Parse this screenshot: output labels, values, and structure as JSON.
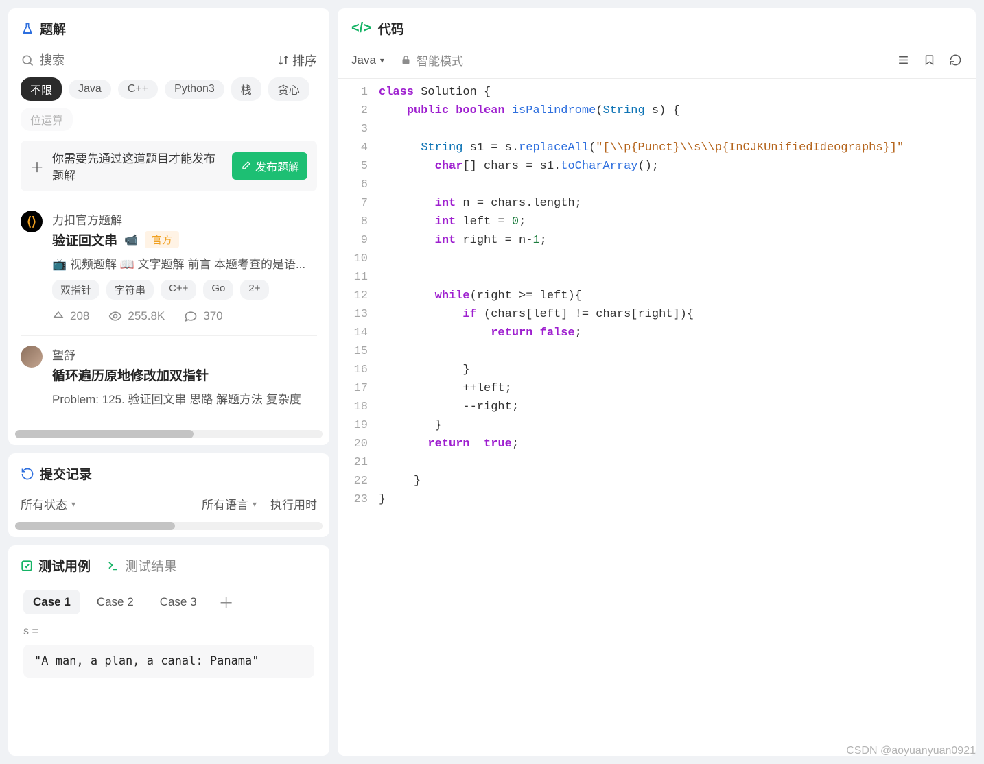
{
  "left": {
    "solutions": {
      "title": "题解",
      "search_placeholder": "搜索",
      "sort_label": "排序",
      "filters": [
        {
          "label": "不限",
          "active": true
        },
        {
          "label": "Java"
        },
        {
          "label": "C++"
        },
        {
          "label": "Python3"
        },
        {
          "label": "栈"
        },
        {
          "label": "贪心"
        },
        {
          "label": "位运算",
          "faded": true
        }
      ],
      "publish_hint": "你需要先通过这道题目才能发布题解",
      "publish_button": "发布题解",
      "items": [
        {
          "author": "力扣官方题解",
          "title": "验证回文串",
          "official_badge": "官方",
          "description": "📺 视频题解 📖 文字题解 前言 本题考查的是语...",
          "tags": [
            "双指针",
            "字符串",
            "C++",
            "Go",
            "2+"
          ],
          "stats": {
            "upvotes": "208",
            "views": "255.8K",
            "comments": "370"
          }
        },
        {
          "author": "望舒",
          "title": "循环遍历原地修改加双指针",
          "description": "Problem: 125. 验证回文串 思路 解题方法 复杂度"
        }
      ]
    },
    "submissions": {
      "title": "提交记录",
      "status_filter": "所有状态",
      "lang_filter": "所有语言",
      "time_filter": "执行用时"
    },
    "tests": {
      "tab_cases": "测试用例",
      "tab_results": "测试结果",
      "cases": [
        "Case 1",
        "Case 2",
        "Case 3"
      ],
      "active_case": 0,
      "var_label": "s =",
      "case_value": "\"A man, a plan, a canal: Panama\""
    }
  },
  "right": {
    "title": "代码",
    "language": "Java",
    "mode_label": "智能模式",
    "code": {
      "lines": [
        [
          [
            "kw",
            "class"
          ],
          [
            "",
            " Solution {"
          ]
        ],
        [
          [
            "",
            "    "
          ],
          [
            "kw",
            "public"
          ],
          [
            "",
            " "
          ],
          [
            "kw",
            "boolean"
          ],
          [
            "",
            " "
          ],
          [
            "fn",
            "isPalindrome"
          ],
          [
            "",
            "("
          ],
          [
            "type",
            "String"
          ],
          [
            "",
            " s) {"
          ]
        ],
        [
          [
            "",
            ""
          ]
        ],
        [
          [
            "",
            "      "
          ],
          [
            "type",
            "String"
          ],
          [
            "",
            " s1 = s."
          ],
          [
            "fn",
            "replaceAll"
          ],
          [
            "",
            "("
          ],
          [
            "str",
            "\"[\\\\p{Punct}\\\\s\\\\p{InCJKUnifiedIdeographs}]\""
          ]
        ],
        [
          [
            "",
            "        "
          ],
          [
            "kw",
            "char"
          ],
          [
            "",
            "[] chars = s1."
          ],
          [
            "fn",
            "toCharArray"
          ],
          [
            "",
            "();"
          ]
        ],
        [
          [
            "",
            ""
          ]
        ],
        [
          [
            "",
            "        "
          ],
          [
            "kw",
            "int"
          ],
          [
            "",
            " n = chars.length;"
          ]
        ],
        [
          [
            "",
            "        "
          ],
          [
            "kw",
            "int"
          ],
          [
            "",
            " left = "
          ],
          [
            "num",
            "0"
          ],
          [
            "",
            ";"
          ]
        ],
        [
          [
            "",
            "        "
          ],
          [
            "kw",
            "int"
          ],
          [
            "",
            " right = n-"
          ],
          [
            "num",
            "1"
          ],
          [
            "",
            ";"
          ]
        ],
        [
          [
            "",
            ""
          ]
        ],
        [
          [
            "",
            ""
          ]
        ],
        [
          [
            "",
            "        "
          ],
          [
            "kw",
            "while"
          ],
          [
            "",
            "(right >= left){"
          ]
        ],
        [
          [
            "",
            "            "
          ],
          [
            "kw",
            "if"
          ],
          [
            "",
            " (chars[left] != chars[right]){"
          ]
        ],
        [
          [
            "",
            "                "
          ],
          [
            "kw",
            "return"
          ],
          [
            "",
            " "
          ],
          [
            "bool",
            "false"
          ],
          [
            "",
            ";"
          ]
        ],
        [
          [
            "",
            ""
          ]
        ],
        [
          [
            "",
            "            }"
          ]
        ],
        [
          [
            "",
            "            ++left;"
          ]
        ],
        [
          [
            "",
            "            --right;"
          ]
        ],
        [
          [
            "",
            "        }"
          ]
        ],
        [
          [
            "",
            "       "
          ],
          [
            "kw",
            "return"
          ],
          [
            "",
            "  "
          ],
          [
            "bool",
            "true"
          ],
          [
            "",
            ";"
          ]
        ],
        [
          [
            "",
            ""
          ]
        ],
        [
          [
            "",
            "     }"
          ]
        ],
        [
          [
            "",
            "}"
          ]
        ]
      ]
    }
  },
  "watermark": "CSDN @aoyuanyuan0921"
}
